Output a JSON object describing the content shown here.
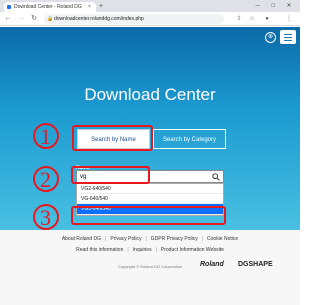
{
  "browser": {
    "tab_title": "Download Center - Roland DG",
    "url": "downloadcenter.rolanddg.com/index.php",
    "tab_close": "×",
    "new_tab": "+",
    "window_controls": [
      "─",
      "□",
      "✕"
    ],
    "nav_icons": [
      "back-icon",
      "forward-icon",
      "reload-icon"
    ],
    "toolbar_icons": [
      "share-icon",
      "star-icon",
      "profile-icon",
      "menu-icon"
    ]
  },
  "hero": {
    "title": "Download Center",
    "search_by_name": "Search by Name",
    "search_by_category": "Search by Category",
    "name_label": "Name",
    "search_value": "vg",
    "dropdown_items": [
      "VG2-640/540",
      "VG-640/540",
      "VG3-640/540"
    ],
    "selected_item": "VG3-640/540",
    "accent_color": "#0d6efd",
    "gradient_top": "#0b6aa8",
    "gradient_bottom": "#49c0e2"
  },
  "annotations": {
    "colors": "#e8191e",
    "steps": [
      "1",
      "2",
      "3"
    ]
  },
  "footer": {
    "links_row1": [
      "About Roland DG",
      "Privacy Policy",
      "GDPR Privacy Policy",
      "Cookie Notice"
    ],
    "links_row2": [
      "Read this information",
      "Inquiries",
      "Product Information Website"
    ],
    "copyright": "Copyright © Roland DG Corporation",
    "logo_roland": "Roland",
    "logo_dgshape": "DGSHAPE"
  }
}
